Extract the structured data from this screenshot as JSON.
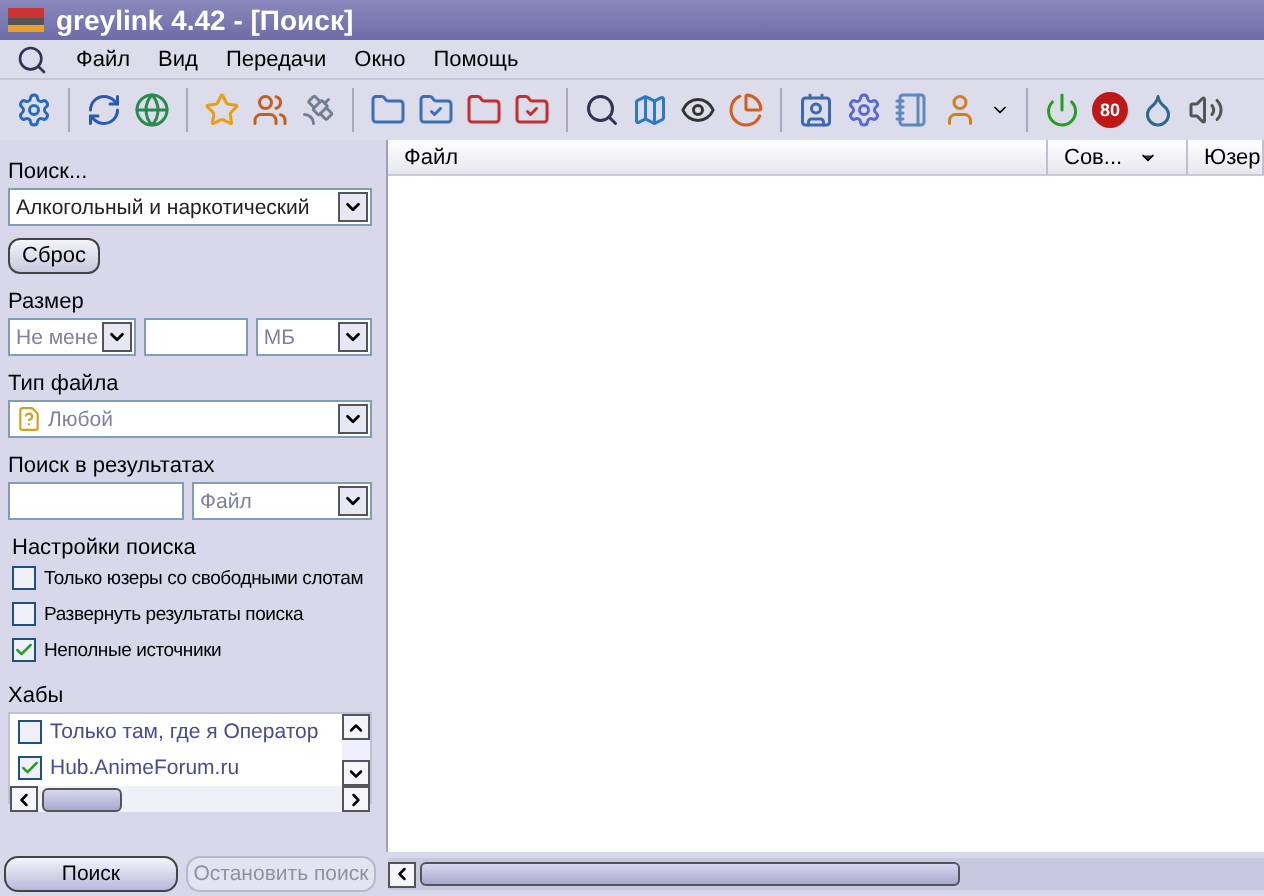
{
  "window": {
    "title": "greylink 4.42 - [Поиск]"
  },
  "menu": [
    "Файл",
    "Вид",
    "Передачи",
    "Окно",
    "Помощь"
  ],
  "toolbar": {
    "badge": "80"
  },
  "search": {
    "label": "Поиск...",
    "value": "Алкогольный и наркотический",
    "reset_button": "Сброс"
  },
  "size": {
    "label": "Размер",
    "mode": "Не мене",
    "unit": "МБ"
  },
  "file_type": {
    "label": "Тип файла",
    "value": "Любой"
  },
  "in_results": {
    "label": "Поиск в результатах",
    "field": "Файл"
  },
  "options": {
    "label": "Настройки поиска",
    "items": [
      {
        "label": "Только юзеры со свободными слотам",
        "checked": false
      },
      {
        "label": "Развернуть результаты поиска",
        "checked": false
      },
      {
        "label": "Неполные источники",
        "checked": true
      }
    ]
  },
  "hubs": {
    "label": "Хабы",
    "items": [
      {
        "label": "Только там, где я Оператор",
        "checked": false
      },
      {
        "label": "Hub.AnimeForum.ru",
        "checked": true
      }
    ]
  },
  "buttons": [
    {
      "label": "Поиск",
      "disabled": false
    },
    {
      "label": "Остановить поиск",
      "disabled": true
    }
  ],
  "table": {
    "columns": [
      "Файл",
      "Сов...",
      "Юзер"
    ]
  }
}
